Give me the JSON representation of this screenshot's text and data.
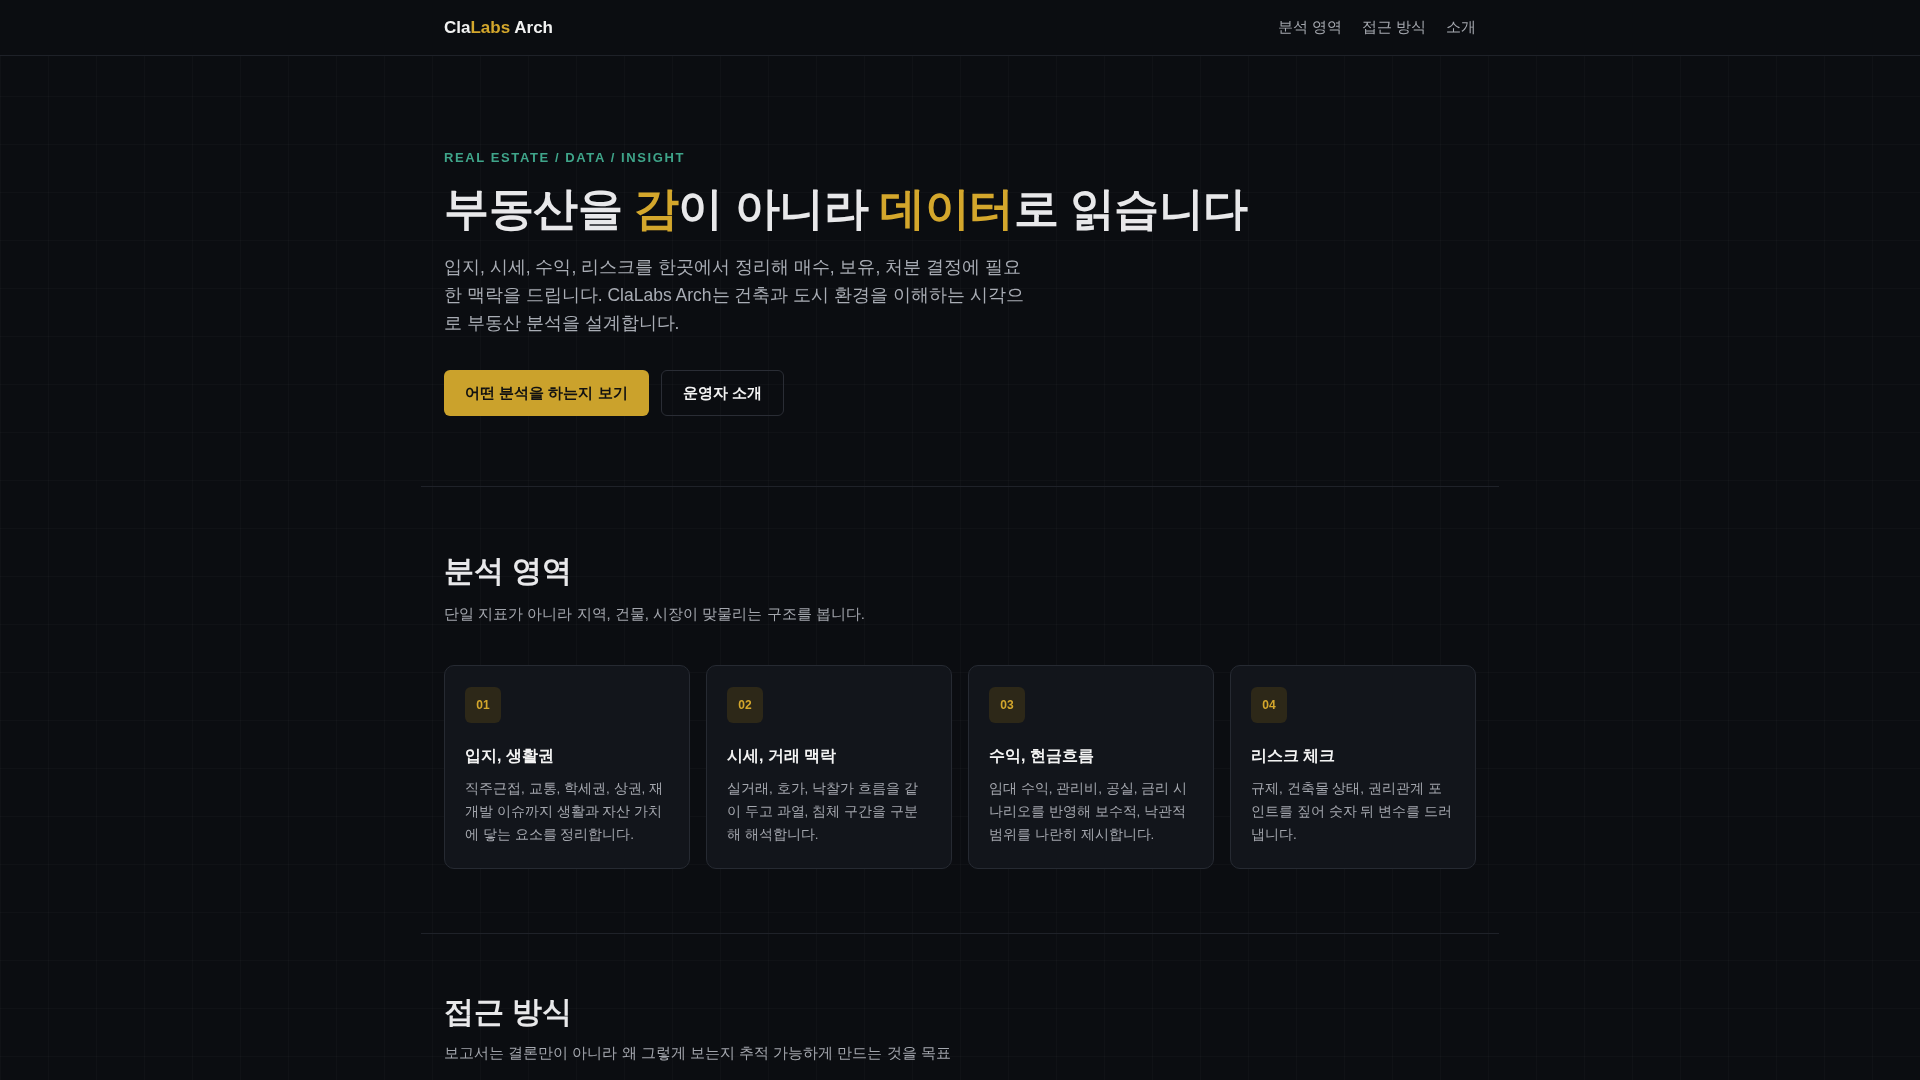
{
  "brand": [
    {
      "text": "Cla",
      "accent": false
    },
    {
      "text": "Labs",
      "accent": true
    },
    {
      "text": " Arch",
      "accent": false
    }
  ],
  "nav": [
    {
      "label": "분석 영역"
    },
    {
      "label": "접근 방식"
    },
    {
      "label": "소개"
    }
  ],
  "hero": {
    "eyebrow": "REAL ESTATE / DATA / INSIGHT",
    "headline": [
      {
        "text": "부동산을 ",
        "accent": false
      },
      {
        "text": "감",
        "accent": true
      },
      {
        "text": "이 아니라 ",
        "accent": false
      },
      {
        "text": "데이터",
        "accent": true
      },
      {
        "text": "로 읽습니다",
        "accent": false
      }
    ],
    "lead": "입지, 시세, 수익, 리스크를 한곳에서 정리해 매수, 보유, 처분 결정에 필요한 맥락을 드립니다. ClaLabs Arch는 건축과 도시 환경을 이해하는 시각으로 부동산 분석을 설계합니다.",
    "buttons": [
      {
        "label": "어떤 분석을 하는지 보기",
        "kind": "primary"
      },
      {
        "label": "운영자 소개",
        "kind": "outline"
      }
    ]
  },
  "analysis": {
    "title": "분석 영역",
    "subtitle": "단일 지표가 아니라 지역, 건물, 시장이 맞물리는 구조를 봅니다.",
    "cards": [
      {
        "number": "01",
        "title": "입지, 생활권",
        "text": "직주근접, 교통, 학세권, 상권, 재개발 이슈까지 생활과 자산 가치에 닿는 요소를 정리합니다."
      },
      {
        "number": "02",
        "title": "시세, 거래 맥락",
        "text": "실거래, 호가, 낙찰가 흐름을 같이 두고 과열, 침체 구간을 구분해 해석합니다."
      },
      {
        "number": "03",
        "title": "수익, 현금흐름",
        "text": "임대 수익, 관리비, 공실, 금리 시나리오를 반영해 보수적, 낙관적 범위를 나란히 제시합니다."
      },
      {
        "number": "04",
        "title": "리스크 체크",
        "text": "규제, 건축물 상태, 권리관계 포인트를 짚어 숫자 뒤 변수를 드러냅니다."
      }
    ]
  },
  "approach": {
    "title": "접근 방식",
    "subtitle": "보고서는 결론만이 아니라 왜 그렇게 보는지 추적 가능하게 만드는 것을 목표"
  }
}
